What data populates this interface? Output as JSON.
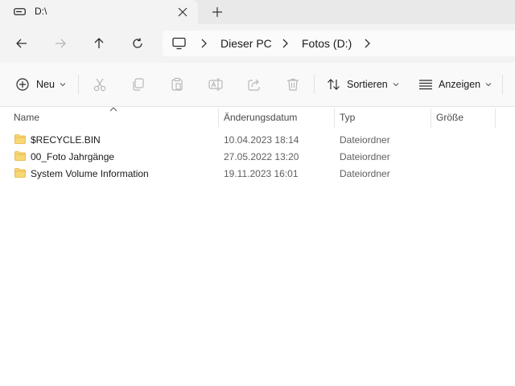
{
  "tab": {
    "title": "D:\\",
    "icon": "drive-icon"
  },
  "address": {
    "crumbs": [
      "Dieser PC",
      "Fotos (D:)"
    ]
  },
  "commands": {
    "new_label": "Neu",
    "sort_label": "Sortieren",
    "view_label": "Anzeigen"
  },
  "columns": {
    "name": "Name",
    "date": "Änderungsdatum",
    "type": "Typ",
    "size": "Größe"
  },
  "files": [
    {
      "name": "$RECYCLE.BIN",
      "date": "10.04.2023 18:14",
      "type": "Dateiordner",
      "size": ""
    },
    {
      "name": "00_Foto Jahrgänge",
      "date": "27.05.2022 13:20",
      "type": "Dateiordner",
      "size": ""
    },
    {
      "name": "System Volume Information",
      "date": "19.11.2023 16:01",
      "type": "Dateiordner",
      "size": ""
    }
  ],
  "colors": {
    "tab_active": "#f3f3f3",
    "tabstrip": "#e9e9e9",
    "folder": "#f5c542",
    "accent": "#005fb8"
  }
}
